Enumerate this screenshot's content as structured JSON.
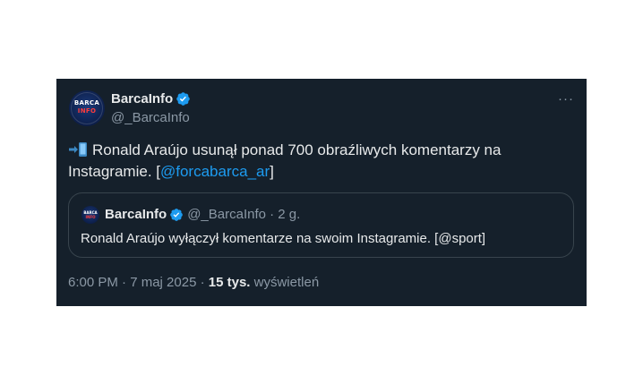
{
  "author": {
    "name": "BarcaInfo",
    "handle": "@_BarcaInfo",
    "avatar_text_top": "BARCA",
    "avatar_text_bottom": "INFO"
  },
  "more_label": "···",
  "tweet": {
    "text_part1": "Ronald Araújo usunął ponad 700 obraźliwych komentarzy na Instagramie. [",
    "mention": "@forcabarca_ar",
    "text_part2": "]"
  },
  "quote": {
    "name": "BarcaInfo",
    "handle_time": "@_BarcaInfo · 2 g.",
    "text": "Ronald Araújo wyłączył komentarze na swoim Instagramie. [@sport]"
  },
  "meta": {
    "time": "6:00 PM · 7 maj 2025",
    "separator": " · ",
    "views_count": "15 tys.",
    "views_label": " wyświetleń"
  },
  "colors": {
    "background": "#15202b",
    "text": "#e7e9ea",
    "secondary": "#8b98a5",
    "accent": "#1d9bf0",
    "border": "#38444d"
  },
  "icons": [
    "verified-badge-icon",
    "more-icon",
    "arrow-phone-emoji-icon"
  ]
}
